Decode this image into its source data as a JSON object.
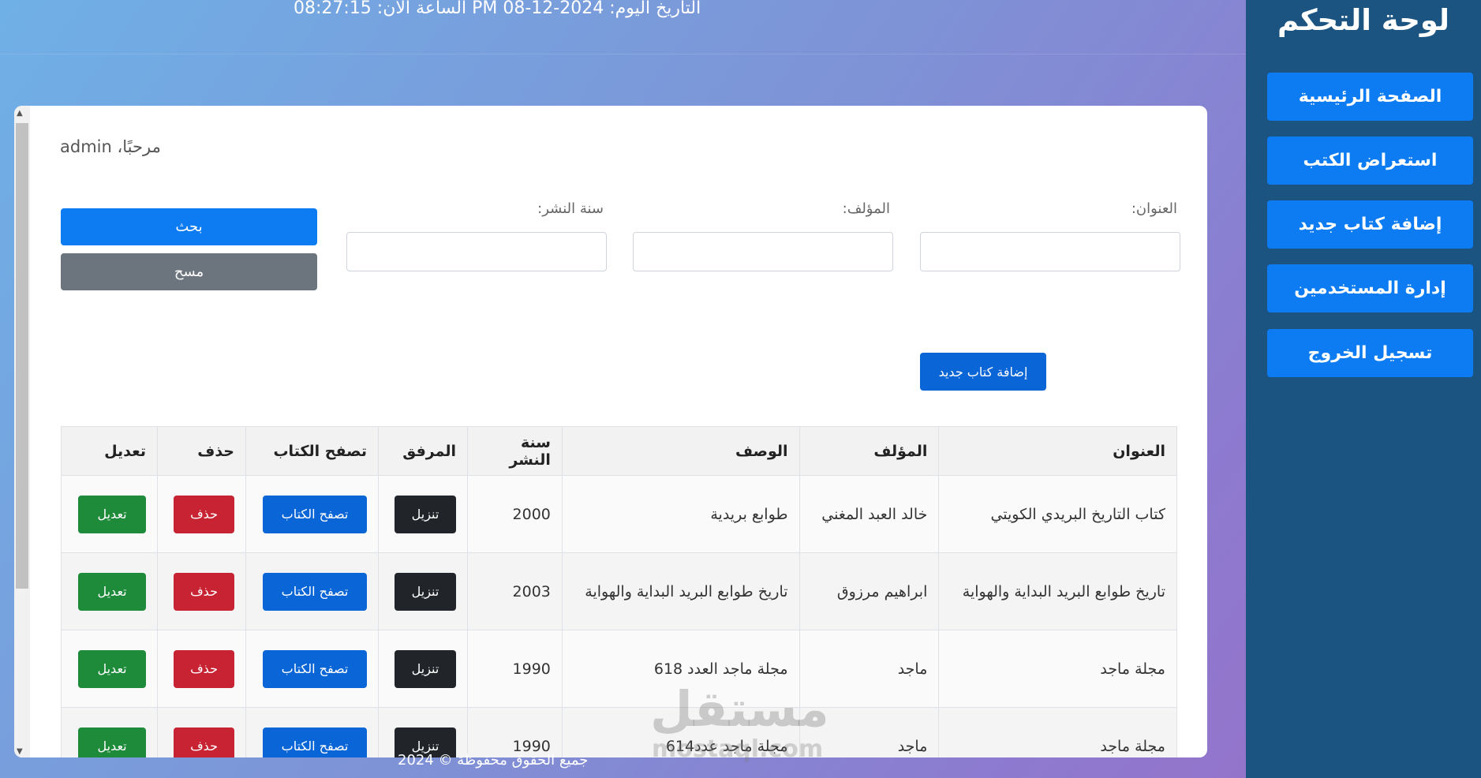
{
  "sidebar": {
    "title": "لوحة التحكم",
    "items": [
      {
        "label": "الصفحة الرئيسية"
      },
      {
        "label": "استعراض الكتب"
      },
      {
        "label": "إضافة كتاب جديد"
      },
      {
        "label": "إدارة المستخدمين"
      },
      {
        "label": "تسجيل الخروج"
      }
    ]
  },
  "header": {
    "clock_text": "الساعة الآن: 08:27:15 PM التاريخ اليوم: 2024-12-08"
  },
  "main": {
    "welcome": "مرحبًا، admin",
    "search": {
      "title_label": "العنوان:",
      "title_value": "",
      "author_label": "المؤلف:",
      "author_value": "",
      "year_label": "سنة النشر:",
      "year_value": "",
      "search_button": "بحث",
      "clear_button": "مسح"
    },
    "add_book_button": "إضافة كتاب جديد",
    "table": {
      "headers": [
        "العنوان",
        "المؤلف",
        "الوصف",
        "سنة النشر",
        "المرفق",
        "تصفح الكتاب",
        "حذف",
        "تعديل"
      ],
      "rows": [
        {
          "title": "كتاب التاريخ البريدي الكويتي",
          "author": "خالد العبد المغني",
          "description": "طوابع بريدية",
          "year": "2000",
          "download": "تنزيل",
          "browse": "تصفح الكتاب",
          "delete": "حذف",
          "edit": "تعديل"
        },
        {
          "title": "تاريخ طوابع البريد البداية والهواية",
          "author": "ابراهيم مرزوق",
          "description": "تاريخ طوابع البريد البداية والهواية",
          "year": "2003",
          "download": "تنزيل",
          "browse": "تصفح الكتاب",
          "delete": "حذف",
          "edit": "تعديل"
        },
        {
          "title": "مجلة ماجد",
          "author": "ماجد",
          "description": "مجلة ماجد العدد 618",
          "year": "1990",
          "download": "تنزيل",
          "browse": "تصفح الكتاب",
          "delete": "حذف",
          "edit": "تعديل"
        },
        {
          "title": "مجلة ماجد",
          "author": "ماجد",
          "description": "مجلة ماجد عدد614",
          "year": "1990",
          "download": "تنزيل",
          "browse": "تصفح الكتاب",
          "delete": "حذف",
          "edit": "تعديل"
        }
      ]
    }
  },
  "footer": {
    "text": "جميع الحقوق محفوظة © 2024"
  },
  "watermark": {
    "text": "مستقل",
    "sub": "mostaql.com"
  },
  "colors": {
    "sidebar_bg": "#1b5480",
    "primary": "#0d7cf2",
    "secondary": "#6c757d",
    "danger": "#c82333",
    "success": "#1e8b3b",
    "dark": "#212529"
  }
}
